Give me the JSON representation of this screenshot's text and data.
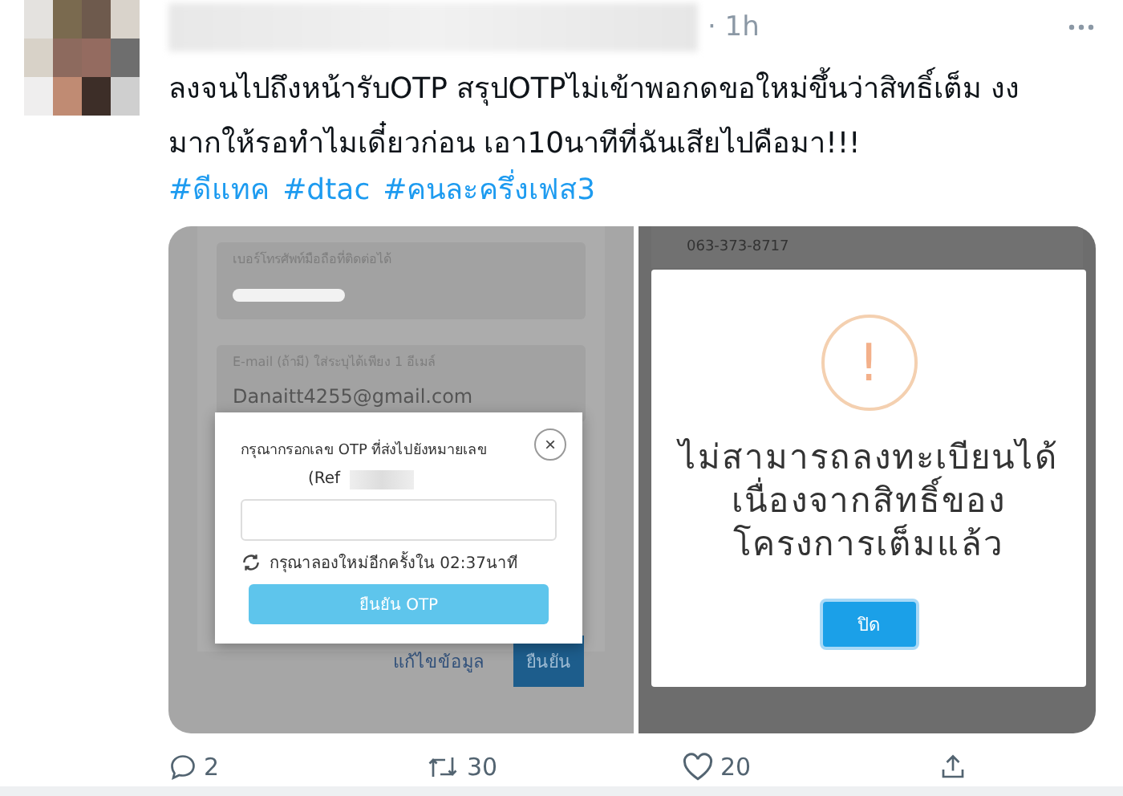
{
  "post": {
    "time": "· 1h",
    "lines": [
      "ลงจนไปถึงหน้ารับOTP สรุปOTPไม่เข้าพอกดขอใหม่ขึ้นว่าสิทธิ์เต็ม งง",
      "มากให้รอทำไมเดี๋ยวก่อน เอา10นาทีที่ฉันเสียไปคือมา!!!"
    ],
    "hashtags": [
      "#ดีแทค",
      "#dtac",
      "#คนละครึ่งเฟส3"
    ]
  },
  "otp_screen": {
    "fields": [
      {
        "label": "เบอร์โทรศัพท์มือถือที่ติดต่อได้"
      },
      {
        "label": "E-mail (ถ้ามี) ใส่ระบุได้เพียง 1 อีเมล์",
        "value": "Danaitt4255@gmail.com"
      }
    ],
    "dialog": {
      "message": "กรุณากรอกเลข OTP ที่ส่งไปยังหมายเลข",
      "ref": "(Ref",
      "retry": "กรุณาลองใหม่อีกครั้งใน 02:37นาที",
      "submit": "ยืนยัน OTP",
      "close": "×"
    },
    "edit_link": "แก้ไขข้อมูล",
    "confirm": "ยืนยัน"
  },
  "alert_screen": {
    "phone": "063-373-8717",
    "icon": "!",
    "message_lines": [
      "ไม่สามารถลงทะเบียนได้",
      "เนื่องจากสิทธิ์ของ",
      "โครงการเต็มแล้ว"
    ],
    "button": "ปิด"
  },
  "actions": [
    {
      "kind": "reply",
      "count": "2"
    },
    {
      "kind": "retweet",
      "count": "30"
    },
    {
      "kind": "like",
      "count": "20"
    },
    {
      "kind": "share"
    }
  ]
}
